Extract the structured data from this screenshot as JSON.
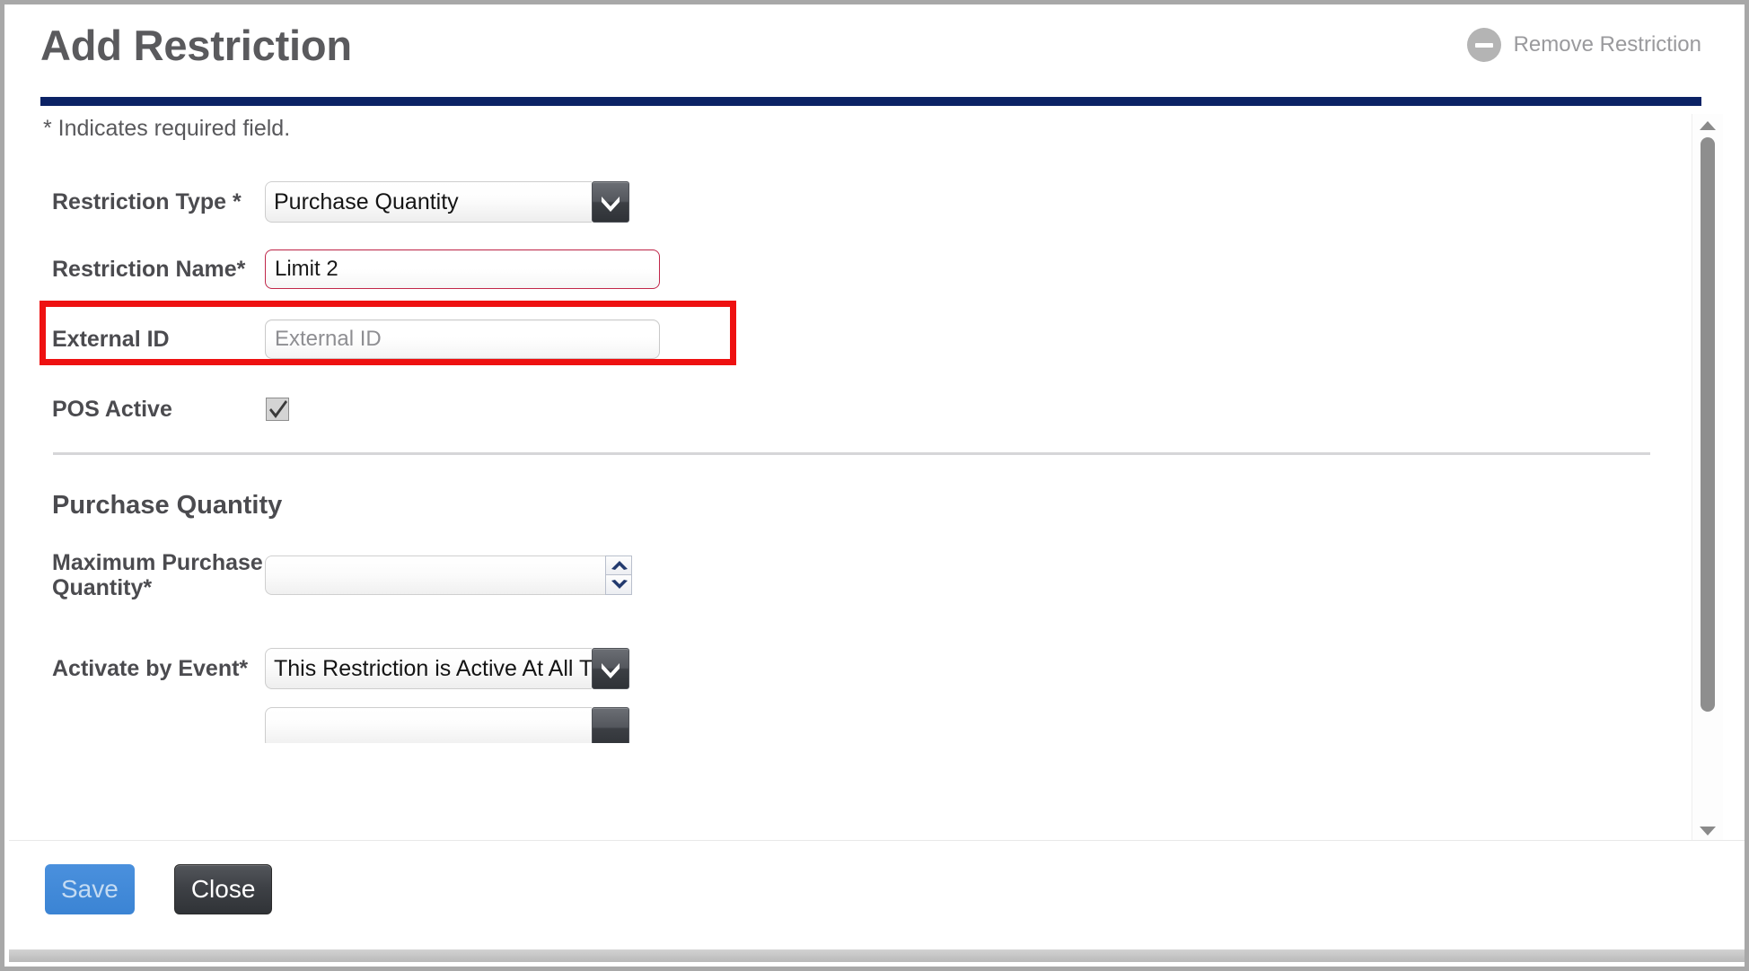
{
  "window": {
    "title": "Add Restriction",
    "accent_color": "#0b2265",
    "highlight_color": "#ee1111"
  },
  "header": {
    "title": "Add Restriction",
    "remove_restriction_label": "Remove Restriction",
    "remove_restriction_icon": "minus-circle-icon"
  },
  "form": {
    "required_note": "* Indicates required field.",
    "fields": {
      "restriction_type": {
        "label": "Restriction Type *",
        "value": "Purchase Quantity",
        "control": "select"
      },
      "restriction_name": {
        "label": "Restriction Name*",
        "value": "Limit 2",
        "placeholder": "",
        "control": "text",
        "highlighted": true
      },
      "external_id": {
        "label": "External ID",
        "value": "",
        "placeholder": "External ID",
        "control": "text"
      },
      "pos_active": {
        "label": "POS Active",
        "checked": true,
        "control": "checkbox"
      }
    },
    "purchase_quantity_section": {
      "heading": "Purchase Quantity",
      "fields": {
        "maximum_purchase_quantity": {
          "label": "Maximum Purchase Quantity*",
          "value": "",
          "placeholder": "",
          "control": "number-spinner"
        },
        "activate_by_event": {
          "label": "Activate by Event*",
          "value": "This Restriction is Active At All Times",
          "control": "select"
        }
      }
    }
  },
  "footer": {
    "save_label": "Save",
    "close_label": "Close"
  },
  "scrollbar": {
    "up_icon": "triangle-up-icon",
    "down_icon": "triangle-down-icon"
  }
}
